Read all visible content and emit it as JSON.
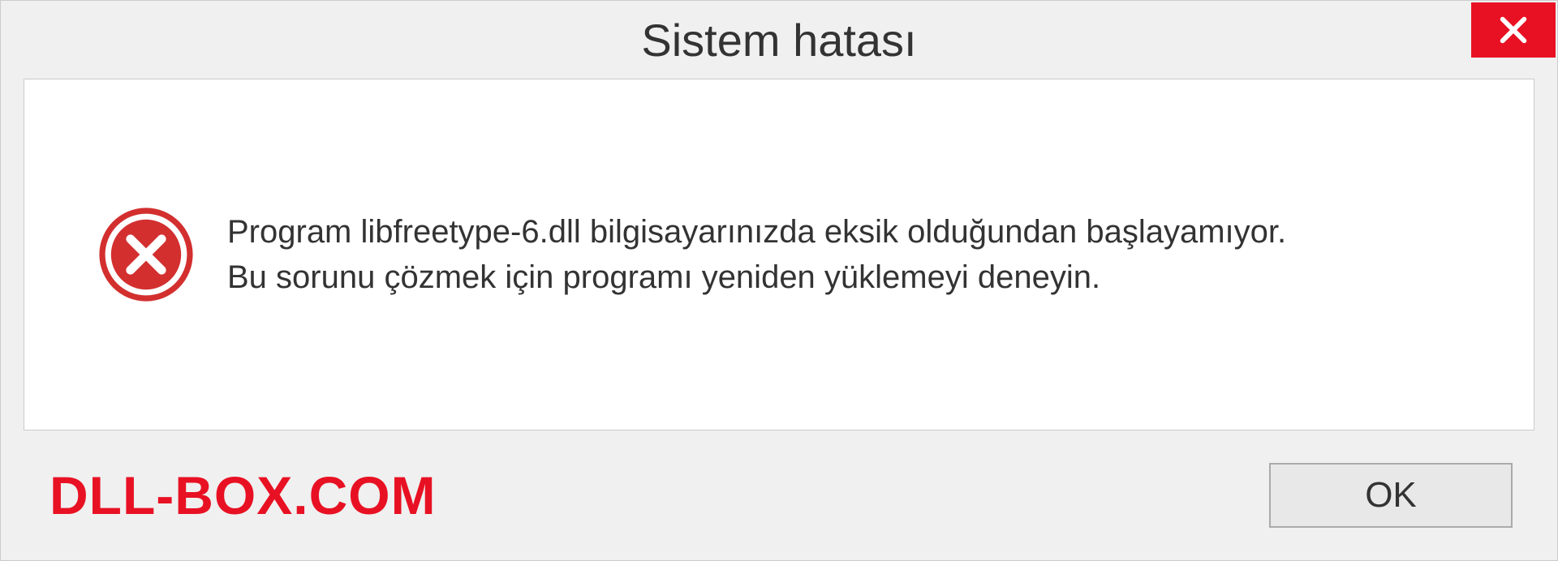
{
  "dialog": {
    "title": "Sistem hatası",
    "message_line1": "Program libfreetype-6.dll bilgisayarınızda eksik olduğundan başlayamıyor.",
    "message_line2": "Bu sorunu çözmek için programı yeniden yüklemeyi deneyin.",
    "ok_label": "OK"
  },
  "watermark": "DLL-BOX.COM",
  "colors": {
    "close_red": "#e81123",
    "watermark_red": "#e81123"
  },
  "icons": {
    "close": "close-icon",
    "error": "error-icon"
  }
}
